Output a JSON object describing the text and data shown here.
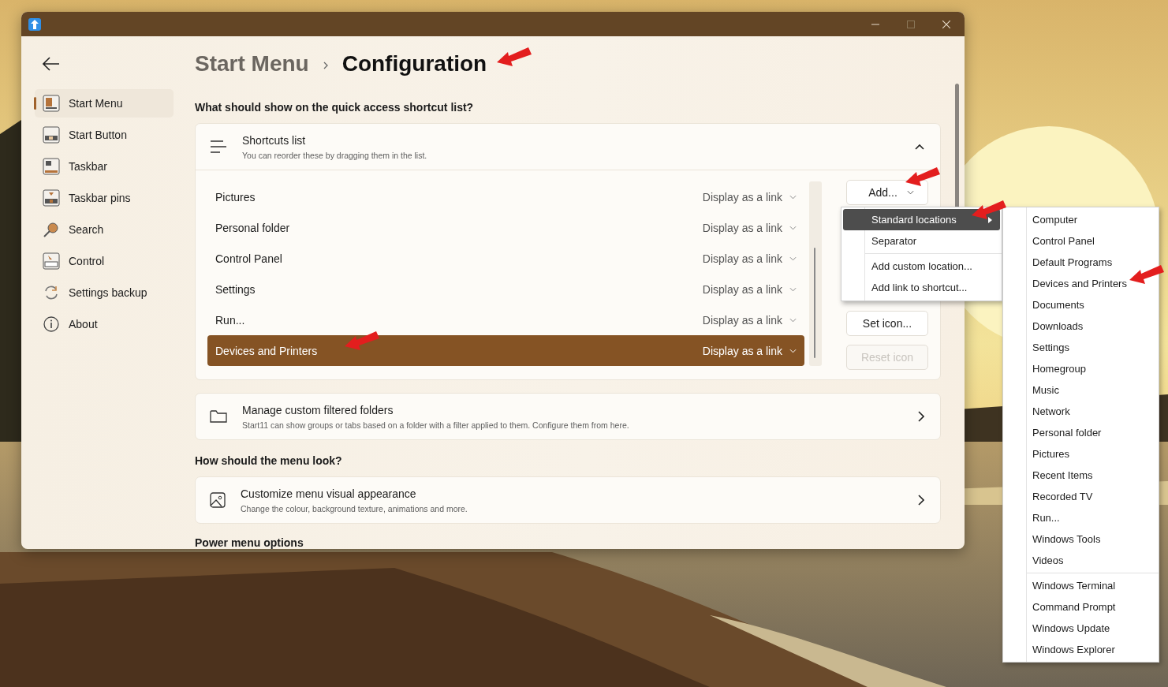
{
  "breadcrumb": [
    {
      "label": "Start Menu",
      "current": false
    },
    {
      "label": "Configuration",
      "current": true
    }
  ],
  "sidebar": {
    "items": [
      {
        "label": "Start Menu",
        "selected": true
      },
      {
        "label": "Start Button",
        "selected": false
      },
      {
        "label": "Taskbar",
        "selected": false
      },
      {
        "label": "Taskbar pins",
        "selected": false
      },
      {
        "label": "Search",
        "selected": false
      },
      {
        "label": "Control",
        "selected": false
      },
      {
        "label": "Settings backup",
        "selected": false
      },
      {
        "label": "About",
        "selected": false
      }
    ]
  },
  "question_1": "What should show on the quick access shortcut list?",
  "shortcuts_card": {
    "title": "Shortcuts list",
    "subtitle": "You can reorder these by dragging them in the list.",
    "expanded": true,
    "rows": [
      {
        "name": "Pictures",
        "display": "Display as a link",
        "selected": false
      },
      {
        "name": "Personal folder",
        "display": "Display as a link",
        "selected": false
      },
      {
        "name": "Control Panel",
        "display": "Display as a link",
        "selected": false
      },
      {
        "name": "Settings",
        "display": "Display as a link",
        "selected": false
      },
      {
        "name": "Run...",
        "display": "Display as a link",
        "selected": false
      },
      {
        "name": "Devices and Printers",
        "display": "Display as a link",
        "selected": true
      }
    ],
    "buttons": [
      {
        "label": "Add...",
        "kind": "dropdown",
        "disabled": false
      },
      {
        "label": "Set icon...",
        "kind": "plain",
        "disabled": false
      },
      {
        "label": "Reset icon",
        "kind": "plain",
        "disabled": true
      }
    ]
  },
  "filtered_folders_card": {
    "title": "Manage custom filtered folders",
    "subtitle": "Start11 can show groups or tabs based on a folder with a filter applied to them.  Configure them from here."
  },
  "question_2": "How should the menu look?",
  "appearance_card": {
    "title": "Customize menu visual appearance",
    "subtitle": "Change the colour, background texture, animations and more."
  },
  "question_3": "Power menu options",
  "add_menu": {
    "items": [
      {
        "kind": "item",
        "label": "Standard locations",
        "selected": true,
        "submenu": true
      },
      {
        "kind": "item",
        "label": "Separator",
        "selected": false,
        "submenu": false
      },
      {
        "kind": "separator"
      },
      {
        "kind": "item",
        "label": "Add custom location...",
        "selected": false,
        "submenu": false
      },
      {
        "kind": "item",
        "label": "Add link to shortcut...",
        "selected": false,
        "submenu": false
      }
    ]
  },
  "submenu": {
    "items": [
      {
        "kind": "item",
        "label": "Computer"
      },
      {
        "kind": "item",
        "label": "Control Panel"
      },
      {
        "kind": "item",
        "label": "Default Programs"
      },
      {
        "kind": "item",
        "label": "Devices and Printers"
      },
      {
        "kind": "item",
        "label": "Documents"
      },
      {
        "kind": "item",
        "label": "Downloads"
      },
      {
        "kind": "item",
        "label": "Settings"
      },
      {
        "kind": "item",
        "label": "Homegroup"
      },
      {
        "kind": "item",
        "label": "Music"
      },
      {
        "kind": "item",
        "label": "Network"
      },
      {
        "kind": "item",
        "label": "Personal folder"
      },
      {
        "kind": "item",
        "label": "Pictures"
      },
      {
        "kind": "item",
        "label": "Recent Items"
      },
      {
        "kind": "item",
        "label": "Recorded TV"
      },
      {
        "kind": "item",
        "label": "Run..."
      },
      {
        "kind": "item",
        "label": "Windows Tools"
      },
      {
        "kind": "item",
        "label": "Videos"
      },
      {
        "kind": "separator"
      },
      {
        "kind": "item",
        "label": "Windows Terminal"
      },
      {
        "kind": "item",
        "label": "Command Prompt"
      },
      {
        "kind": "item",
        "label": "Windows Update"
      },
      {
        "kind": "item",
        "label": "Windows Explorer"
      }
    ]
  }
}
